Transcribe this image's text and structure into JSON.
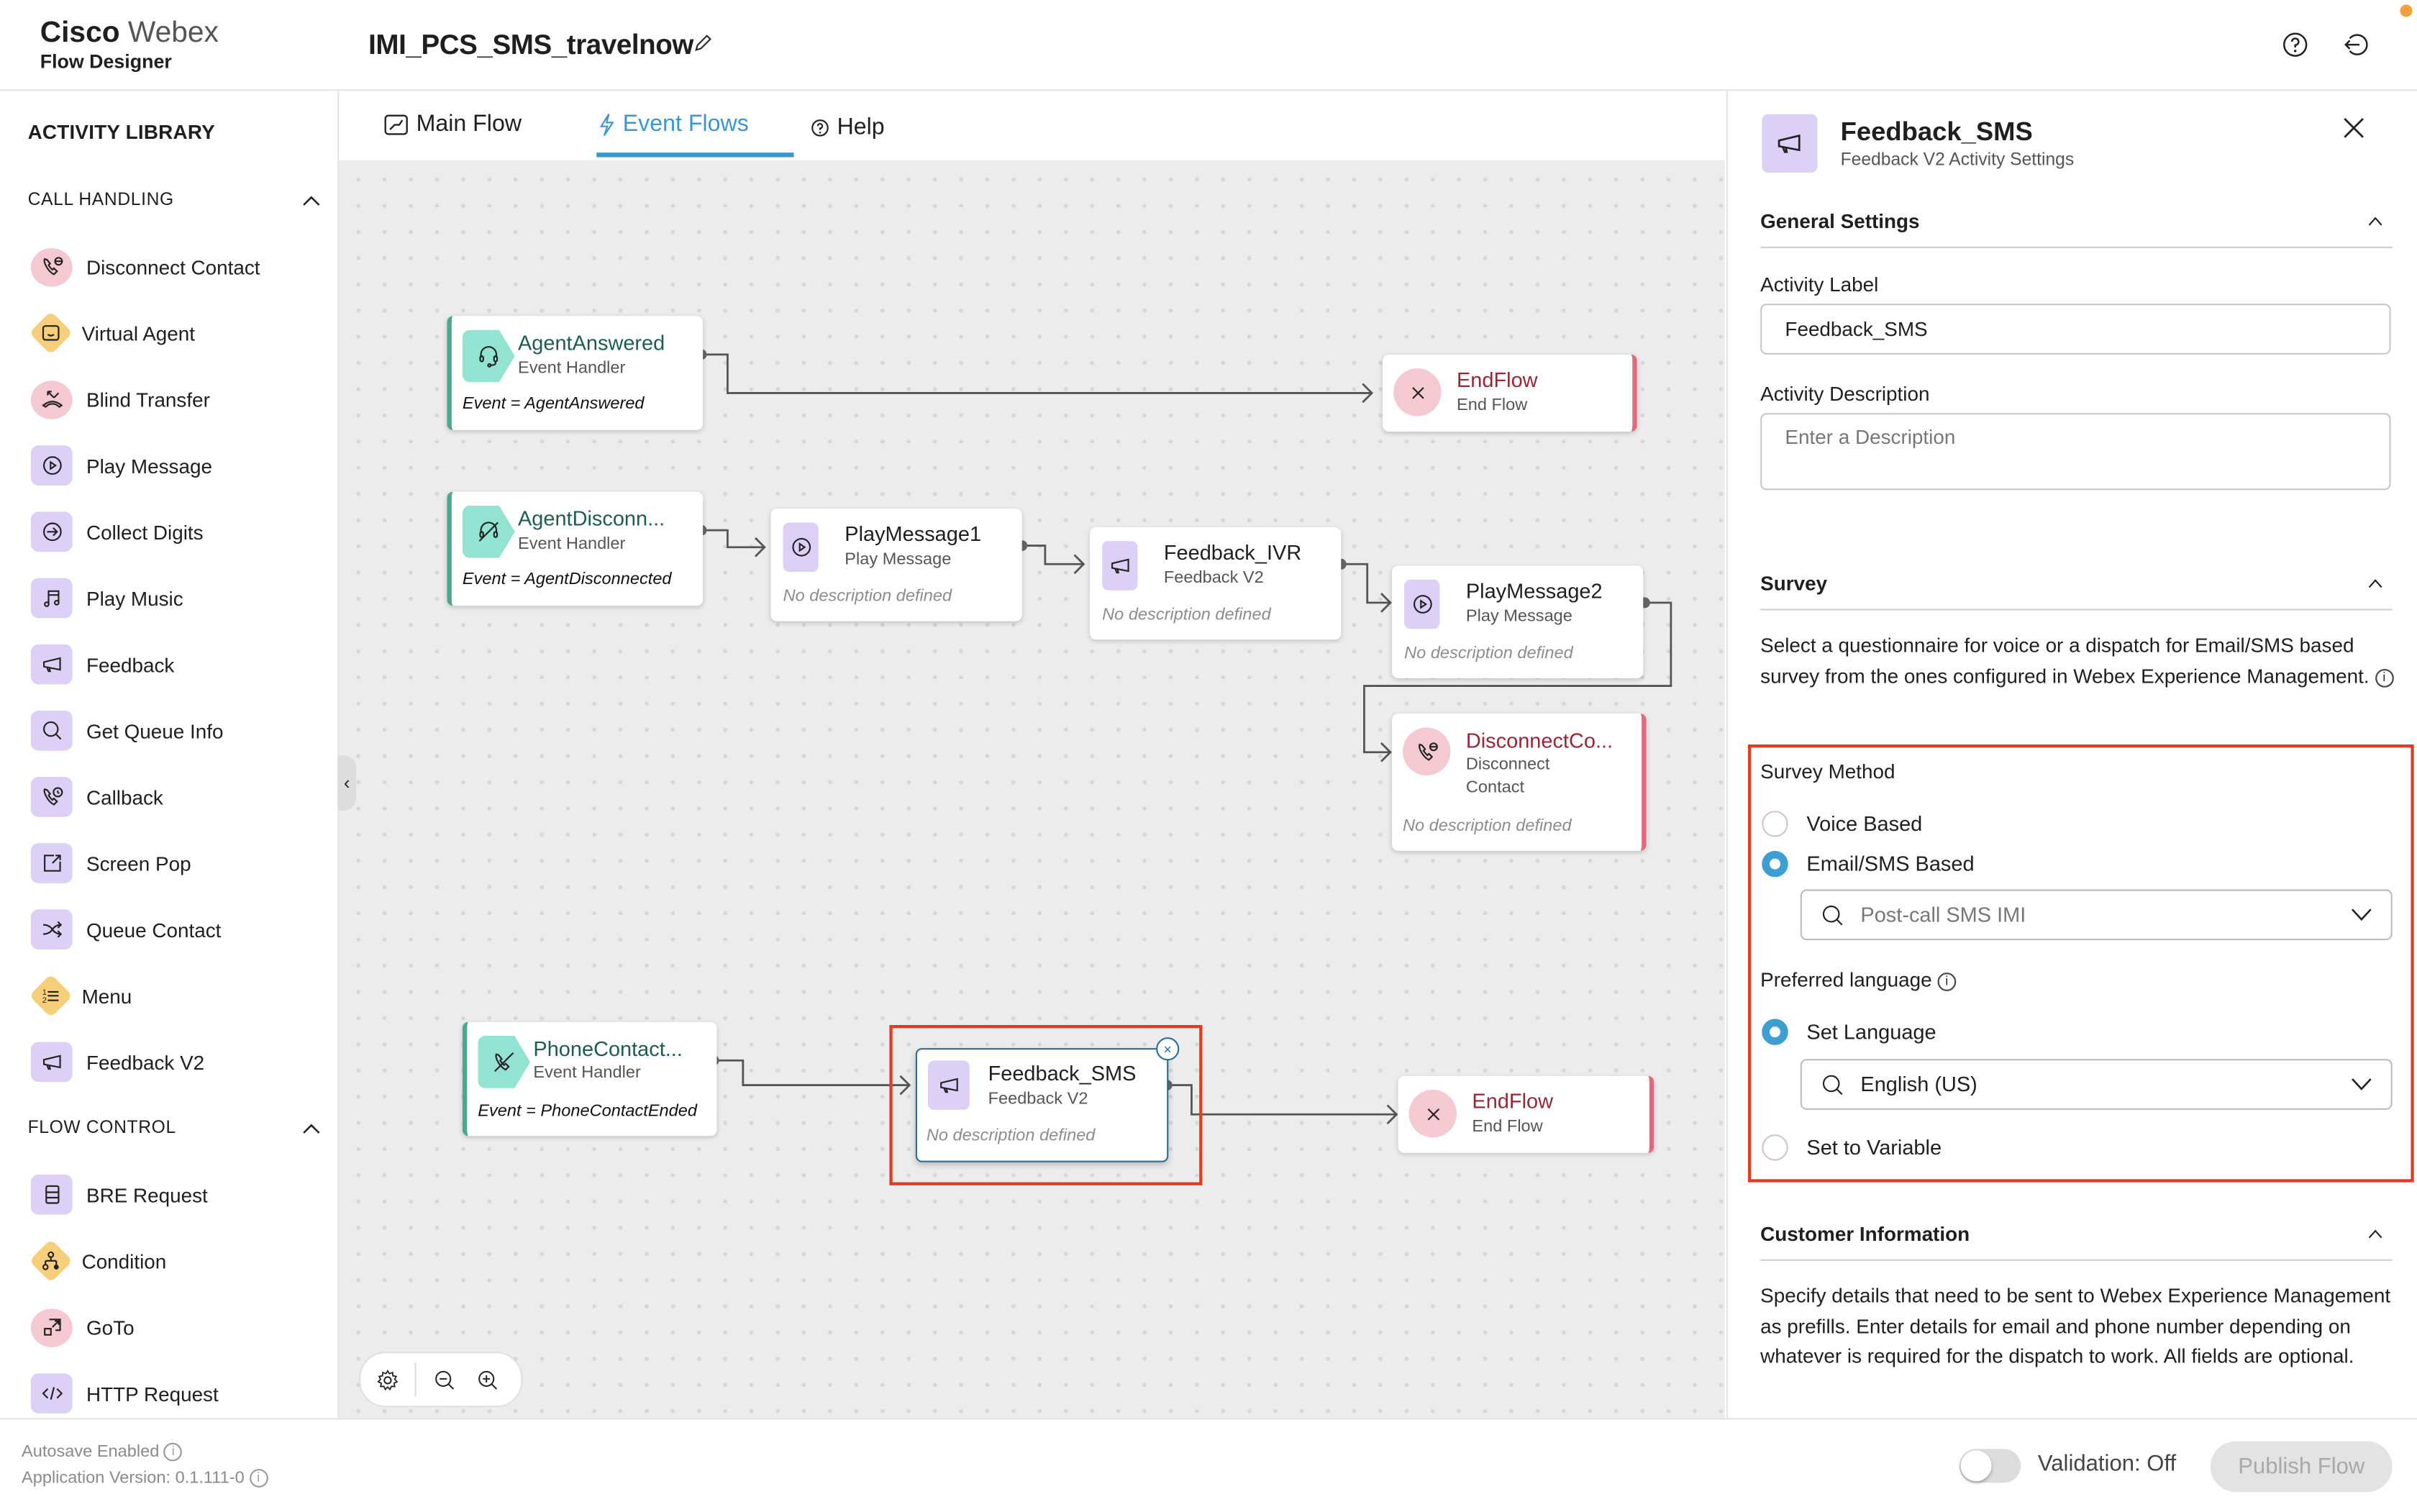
{
  "header": {
    "brand_primary": "Cisco",
    "brand_secondary": "Webex",
    "product": "Flow Designer",
    "flow_name": "IMI_PCS_SMS_travelnow"
  },
  "sidebar": {
    "title": "ACTIVITY LIBRARY",
    "sections": [
      {
        "title": "CALL HANDLING",
        "items": [
          {
            "label": "Disconnect Contact",
            "icon": "disconnect-contact-icon"
          },
          {
            "label": "Virtual Agent",
            "icon": "virtual-agent-icon"
          },
          {
            "label": "Blind Transfer",
            "icon": "blind-transfer-icon"
          },
          {
            "label": "Play Message",
            "icon": "play-message-icon"
          },
          {
            "label": "Collect Digits",
            "icon": "collect-digits-icon"
          },
          {
            "label": "Play Music",
            "icon": "music-note-icon"
          },
          {
            "label": "Feedback",
            "icon": "megaphone-icon"
          },
          {
            "label": "Get Queue Info",
            "icon": "search-icon"
          },
          {
            "label": "Callback",
            "icon": "callback-icon"
          },
          {
            "label": "Screen Pop",
            "icon": "screen-pop-icon"
          },
          {
            "label": "Queue Contact",
            "icon": "shuffle-icon"
          },
          {
            "label": "Menu",
            "icon": "numbered-list-icon"
          },
          {
            "label": "Feedback V2",
            "icon": "megaphone-icon"
          }
        ]
      },
      {
        "title": "FLOW CONTROL",
        "items": [
          {
            "label": "BRE Request",
            "icon": "database-icon"
          },
          {
            "label": "Condition",
            "icon": "condition-icon"
          },
          {
            "label": "GoTo",
            "icon": "goto-icon"
          },
          {
            "label": "HTTP Request",
            "icon": "code-icon"
          }
        ]
      }
    ]
  },
  "tabs": [
    {
      "label": "Main Flow",
      "active": false
    },
    {
      "label": "Event Flows",
      "active": true
    },
    {
      "label": "Help",
      "active": false
    }
  ],
  "canvas": {
    "nodes": {
      "agent_answered": {
        "title": "AgentAnswered",
        "type": "Event Handler",
        "event": "Event = AgentAnswered"
      },
      "endflow_1": {
        "title": "EndFlow",
        "type": "End Flow"
      },
      "agent_disconnected": {
        "title": "AgentDisconn...",
        "type": "Event Handler",
        "event": "Event = AgentDisconnected"
      },
      "playmessage1": {
        "title": "PlayMessage1",
        "type": "Play Message",
        "desc": "No description defined"
      },
      "feedback_ivr": {
        "title": "Feedback_IVR",
        "type": "Feedback V2",
        "desc": "No description defined"
      },
      "playmessage2": {
        "title": "PlayMessage2",
        "type": "Play Message",
        "desc": "No description defined"
      },
      "disconnect_contact": {
        "title": "DisconnectCo...",
        "type_line1": "Disconnect",
        "type_line2": "Contact",
        "desc": "No description defined"
      },
      "phone_contact": {
        "title": "PhoneContact...",
        "type": "Event Handler",
        "event": "Event = PhoneContactEnded"
      },
      "feedback_sms": {
        "title": "Feedback_SMS",
        "type": "Feedback V2",
        "desc": "No description defined",
        "selected": true
      },
      "endflow_2": {
        "title": "EndFlow",
        "type": "End Flow"
      }
    }
  },
  "panel": {
    "title": "Feedback_SMS",
    "subtitle": "Feedback V2 Activity Settings",
    "general": {
      "heading": "General Settings",
      "activity_label_label": "Activity Label",
      "activity_label_value": "Feedback_SMS",
      "activity_desc_label": "Activity Description",
      "activity_desc_placeholder": "Enter a Description"
    },
    "survey": {
      "heading": "Survey",
      "description": "Select a questionnaire for voice or a dispatch for Email/SMS based survey from the ones configured in Webex Experience Management.",
      "method_label": "Survey Method",
      "options": [
        {
          "label": "Voice Based",
          "checked": false
        },
        {
          "label": "Email/SMS Based",
          "checked": true
        }
      ],
      "dispatch_value": "Post-call SMS IMI",
      "language_label": "Preferred language",
      "language_options": [
        {
          "label": "Set Language",
          "checked": true
        },
        {
          "label": "Set to Variable",
          "checked": false
        }
      ],
      "language_value": "English (US)"
    },
    "customer": {
      "heading": "Customer Information",
      "description": "Specify details that need to be sent to Webex Experience Management as prefills. Enter details for email and phone number depending on whatever is required for the dispatch to work. All fields are optional."
    }
  },
  "footer": {
    "autosave": "Autosave Enabled",
    "version": "Application Version: 0.1.111-0",
    "validation_label": "Validation: Off",
    "validation_on": false,
    "publish_label": "Publish Flow"
  },
  "colors": {
    "accent": "#3b97d3",
    "highlight_box": "#e23b24",
    "event_teal": "#93e3d2",
    "activity_purple": "#ddd0f7",
    "end_pink": "#f5c9d1",
    "flow_diamond": "#f7cf7a"
  }
}
